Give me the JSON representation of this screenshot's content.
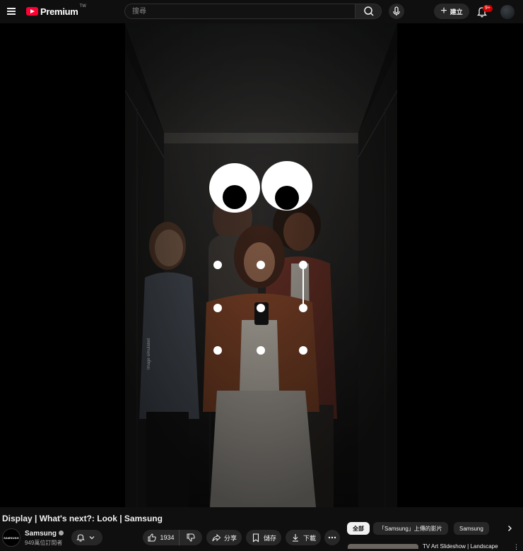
{
  "header": {
    "logo_text": "Premium",
    "logo_region": "TW",
    "search_placeholder": "搜尋",
    "create_label": "建立",
    "notifications_badge": "9+"
  },
  "video": {
    "watermark_text": "Image simulated"
  },
  "below_video": {
    "title": "Display | What's next?: Look | Samsung",
    "channel_name": "Samsung",
    "channel_avatar_text": "SAMSUNG",
    "subscribers": "949萬位訂閱者",
    "like_count": "1934",
    "share_label": "分享",
    "save_label": "儲存",
    "download_label": "下載"
  },
  "chips": [
    {
      "label": "全部",
      "active": true
    },
    {
      "label": "「Samsung」上傳的影片",
      "active": false
    },
    {
      "label": "Samsung",
      "active": false
    }
  ],
  "recommendation": {
    "title": "TV Art Slideshow | Landscape"
  },
  "colors": {
    "background": "#0f0f0f",
    "brand_red": "#ff0033",
    "badge_red": "#cc0000",
    "pill_bg": "#272727"
  }
}
